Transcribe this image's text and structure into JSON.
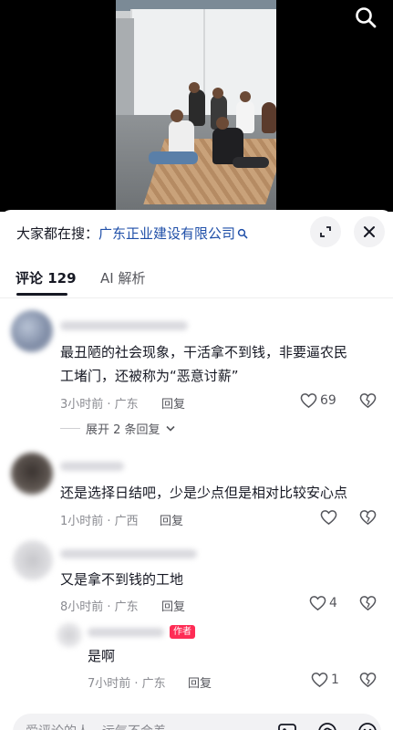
{
  "search_label": "大家都在搜：",
  "search_keyword": "广东正业建设有限公司",
  "tabs": [
    {
      "label": "评论 129",
      "active": true
    },
    {
      "label": "AI 解析",
      "active": false
    }
  ],
  "comments": [
    {
      "text_lines": [
        "最丑陋的社会现象，干活拿不到钱，非要逼农民",
        "工堵门，还被称为“恶意讨薪”"
      ],
      "time": "3小时前 · 广东",
      "reply_label": "回复",
      "likes": "69",
      "expand_replies": "展开 2 条回复"
    },
    {
      "text_lines": [
        "还是选择日结吧，少是少点但是相对比较安心点"
      ],
      "time": "1小时前 · 广西",
      "reply_label": "回复",
      "likes": ""
    },
    {
      "text_lines": [
        "又是拿不到钱的工地"
      ],
      "time": "8小时前 · 广东",
      "reply_label": "回复",
      "likes": "4"
    }
  ],
  "reply": {
    "badge": "作者",
    "text": "是啊",
    "time": "7小时前 · 广东",
    "reply_label": "回复",
    "likes": "1"
  },
  "input_placeholder": "爱评论的人，运气不会差",
  "colors": {
    "accent": "#fe2c55",
    "link": "#1f4fa8"
  },
  "icons": [
    "search-icon",
    "expand-icon",
    "close-icon",
    "heart-icon",
    "broken-heart-icon",
    "chevron-down-icon",
    "image-icon",
    "at-icon",
    "emoji-icon"
  ]
}
